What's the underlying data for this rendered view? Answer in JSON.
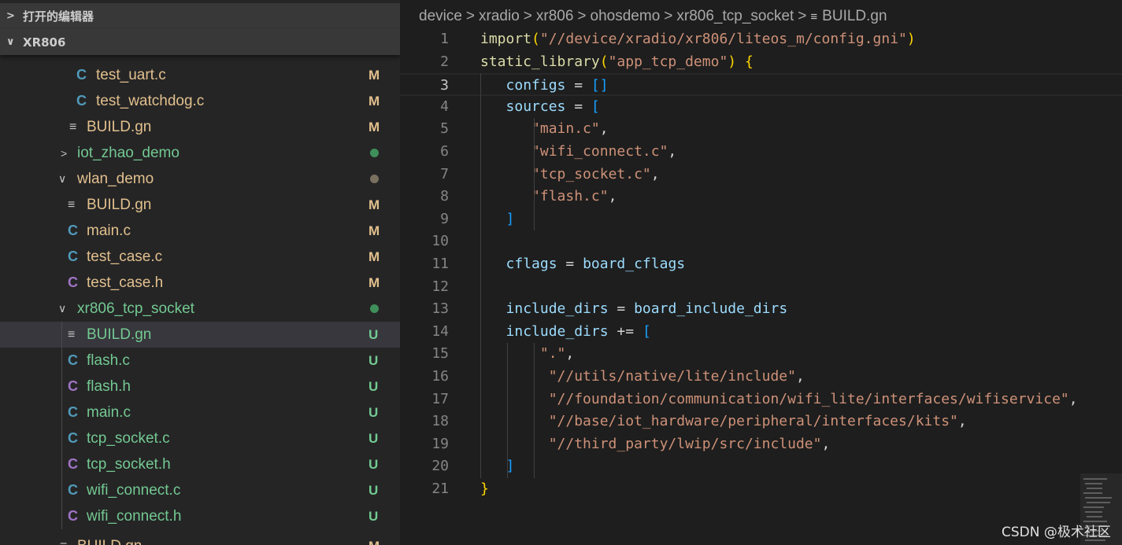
{
  "explorer": {
    "open_editors_label": "打开的编辑器",
    "root_label": "XR806",
    "items": [
      {
        "name": "test_uart.c",
        "type": "c",
        "status": "M"
      },
      {
        "name": "test_watchdog.c",
        "type": "c",
        "status": "M"
      },
      {
        "name": "BUILD.gn",
        "type": "gn",
        "status": "M"
      },
      {
        "name": "iot_zhao_demo",
        "type": "folder-collapsed",
        "status": "dot-green"
      },
      {
        "name": "wlan_demo",
        "type": "folder-expanded",
        "status": "dot-gray"
      },
      {
        "name": "BUILD.gn",
        "type": "gn",
        "status": "M"
      },
      {
        "name": "main.c",
        "type": "c",
        "status": "M"
      },
      {
        "name": "test_case.c",
        "type": "c",
        "status": "M"
      },
      {
        "name": "test_case.h",
        "type": "h",
        "status": "M"
      },
      {
        "name": "xr806_tcp_socket",
        "type": "folder-expanded",
        "status": "dot-green"
      },
      {
        "name": "BUILD.gn",
        "type": "gn",
        "status": "U"
      },
      {
        "name": "flash.c",
        "type": "c",
        "status": "U"
      },
      {
        "name": "flash.h",
        "type": "h",
        "status": "U"
      },
      {
        "name": "main.c",
        "type": "c",
        "status": "U"
      },
      {
        "name": "tcp_socket.c",
        "type": "c",
        "status": "U"
      },
      {
        "name": "tcp_socket.h",
        "type": "h",
        "status": "U"
      },
      {
        "name": "wifi_connect.c",
        "type": "c",
        "status": "U"
      },
      {
        "name": "wifi_connect.h",
        "type": "h",
        "status": "U"
      },
      {
        "name": "BUILD.gn",
        "type": "gn",
        "status": "M"
      }
    ]
  },
  "breadcrumb": [
    "device",
    "xradio",
    "xr806",
    "ohosdemo",
    "xr806_tcp_socket",
    "BUILD.gn"
  ],
  "editor": {
    "active_line": 3,
    "lines": [
      "import(\"//device/xradio/xr806/liteos_m/config.gni\")",
      "static_library(\"app_tcp_demo\") {",
      "   configs = []",
      "   sources = [",
      "      \"main.c\",",
      "      \"wifi_connect.c\",",
      "      \"tcp_socket.c\",",
      "      \"flash.c\",",
      "   ]",
      "",
      "   cflags = board_cflags",
      "",
      "   include_dirs = board_include_dirs",
      "   include_dirs += [",
      "       \".\",",
      "        \"//utils/native/lite/include\",",
      "        \"//foundation/communication/wifi_lite/interfaces/wifiservice\",",
      "        \"//base/iot_hardware/peripheral/interfaces/kits\",",
      "        \"//third_party/lwip/src/include\",",
      "   ]",
      "}"
    ]
  },
  "colors": {
    "modified": "#e2c08d",
    "untracked": "#73c991",
    "modified_label": "#e2c08d",
    "untracked_label": "#73c991",
    "c_icon": "#519aba",
    "h_icon": "#a074c4"
  },
  "watermark": "CSDN @极术社区"
}
